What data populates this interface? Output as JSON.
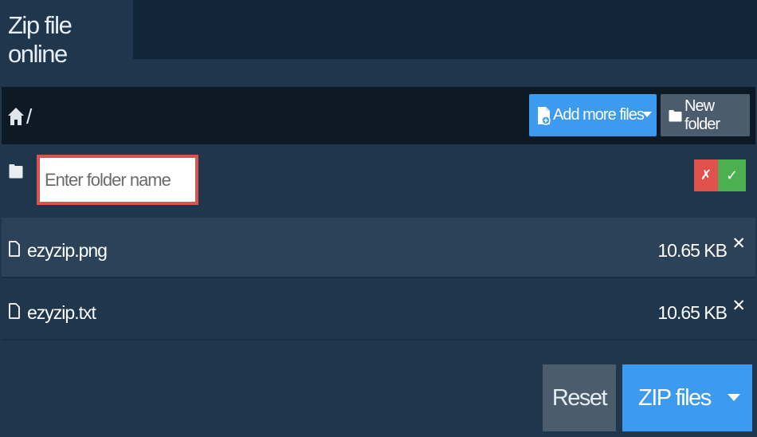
{
  "header": {
    "tab_title": "Zip file online"
  },
  "toolbar": {
    "path_separator": "/",
    "add_files_label": "Add more files",
    "new_folder_label": "New folder"
  },
  "folder_form": {
    "placeholder": "Enter folder name",
    "cancel_glyph": "✗",
    "confirm_glyph": "✓"
  },
  "files": [
    {
      "name": "ezyzip.png",
      "size": "10.65 KB",
      "remove_glyph": "✕"
    },
    {
      "name": "ezyzip.txt",
      "size": "10.65 KB",
      "remove_glyph": "✕"
    }
  ],
  "footer": {
    "reset_label": "Reset",
    "zip_label": "ZIP files"
  },
  "colors": {
    "background": "#1f364d",
    "tabbar": "#12263a",
    "toolbar": "#0d1a26",
    "primary": "#3c9bef",
    "secondary": "#4b5d6d",
    "danger": "#e0514b",
    "success": "#4caf50",
    "highlight_border": "#d9534f"
  },
  "icons": {
    "home": "home-icon",
    "add_file": "file-plus-icon",
    "folder": "folder-icon",
    "file": "file-icon",
    "dropdown": "caret-down-icon"
  }
}
